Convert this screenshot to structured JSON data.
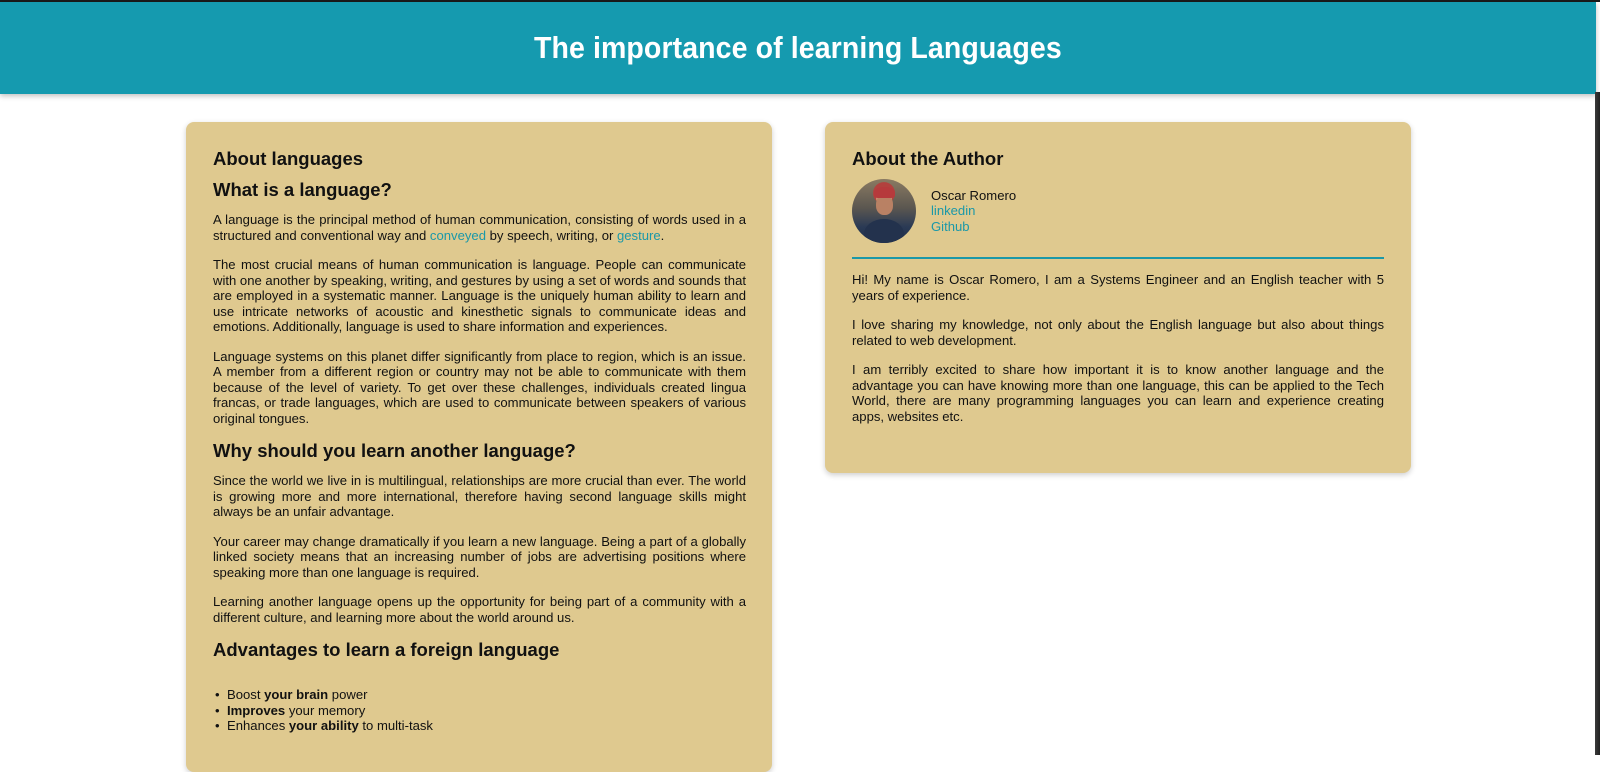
{
  "header": {
    "title": "The importance of learning Languages"
  },
  "left_card": {
    "title": "About languages",
    "what": {
      "heading": "What is a language?",
      "p1_a": "A language is the principal method of human communication, consisting of words used in a structured and conventional way and ",
      "p1_link1": "conveyed",
      "p1_b": " by speech, writing, or ",
      "p1_link2": "gesture",
      "p1_c": ".",
      "p2": "The most crucial means of human communication is language. People can communicate with one another by speaking, writing, and gestures by using a set of words and sounds that are employed in a systematic manner. Language is the uniquely human ability to learn and use intricate networks of acoustic and kinesthetic signals to communicate ideas and emotions. Additionally, language is used to share information and experiences.",
      "p3": "Language systems on this planet differ significantly from place to region, which is an issue. A member from a different region or country may not be able to communicate with them because of the level of variety. To get over these challenges, individuals created lingua francas, or trade languages, which are used to communicate between speakers of various original tongues."
    },
    "why": {
      "heading": "Why should you learn another language?",
      "p1": "Since the world we live in is multilingual, relationships are more crucial than ever. The world is growing more and more international, therefore having second language skills might always be an unfair advantage.",
      "p2": "Your career may change dramatically if you learn a new language. Being a part of a globally linked society means that an increasing number of jobs are advertising positions where speaking more than one language is required.",
      "p3": "Learning another language opens up the opportunity for being part of a community with a different culture, and learning more about the world around us."
    },
    "advantages": {
      "heading": "Advantages to learn a foreign language",
      "items": [
        {
          "pre": "Boost ",
          "bold": "your brain",
          "post": " power"
        },
        {
          "pre": "",
          "bold": "Improves",
          "post": " your memory"
        },
        {
          "pre": "Enhances ",
          "bold": "your ability",
          "post": " to multi-task"
        }
      ]
    }
  },
  "right_card": {
    "title": "About the Author",
    "author_name": "Oscar Romero",
    "link_linkedin": "linkedin",
    "link_github": "Github",
    "p1": "Hi! My name is Oscar Romero, I am a Systems Engineer and an English teacher with 5 years of experience.",
    "p2": "I love sharing my knowledge, not only about the English language but also about things related to web development.",
    "p3": "I am terribly excited to share how important it is to know another language and the advantage you can have knowing more than one language, this can be applied to the Tech World, there are many programming languages you can learn and experience creating apps, websites etc."
  },
  "colors": {
    "header_bg": "#159aaf",
    "card_bg": "#dfc98f",
    "link": "#1b98a8"
  }
}
